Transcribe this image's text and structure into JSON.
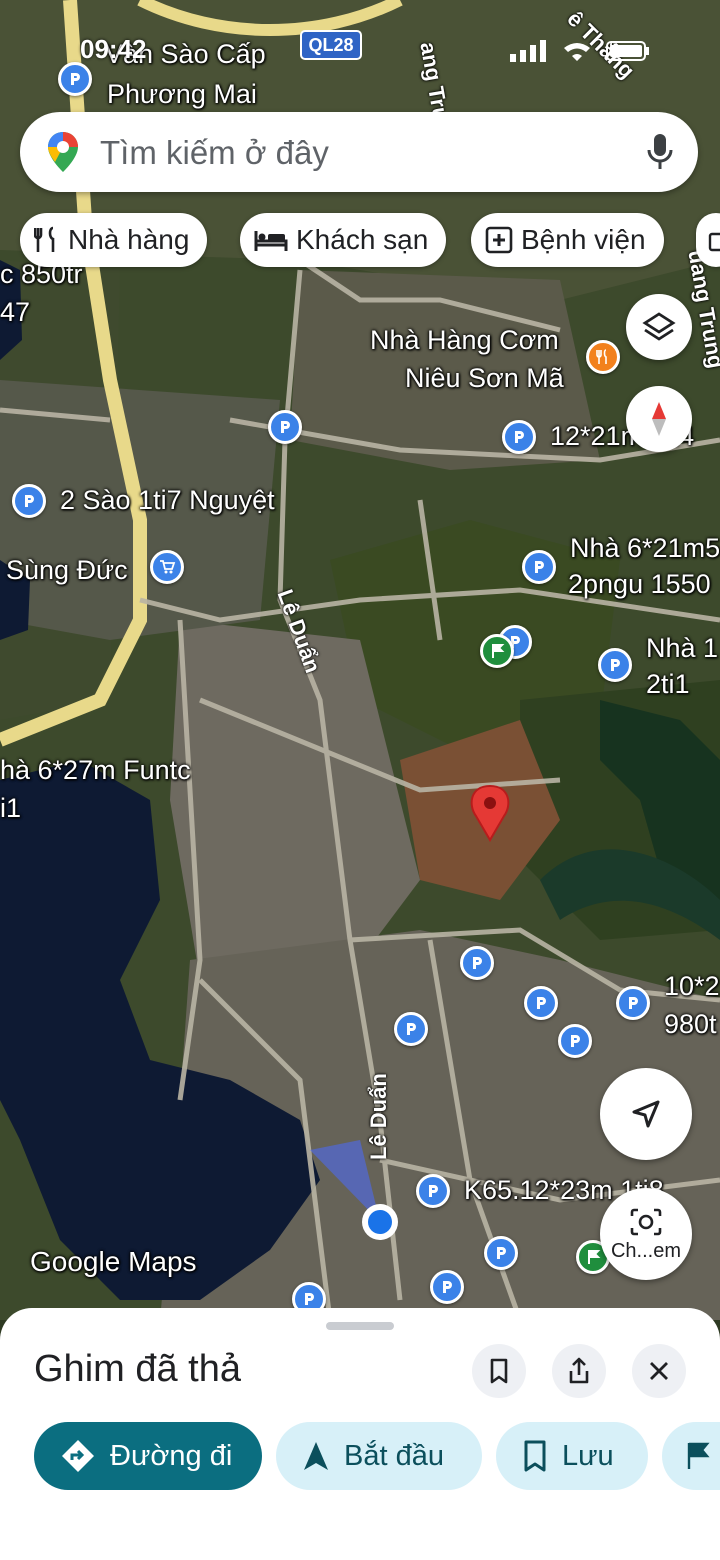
{
  "status_bar": {
    "time": "09:42"
  },
  "map": {
    "shields": [
      {
        "id": "QL28",
        "text": "QL28"
      }
    ],
    "labels": [
      {
        "id": "van-sao-1",
        "text": "Vàn Sào Cấp"
      },
      {
        "id": "van-sao-2",
        "text": "Phương Mai"
      },
      {
        "id": "quang-trung-top",
        "text": "ang Trung"
      },
      {
        "id": "le-thang",
        "text": "ê Thắng"
      },
      {
        "id": "c850",
        "text": "c 850tr"
      },
      {
        "id": "c47",
        "text": "47"
      },
      {
        "id": "nha-hang-1",
        "text": "Nhà Hàng Cơm"
      },
      {
        "id": "nha-hang-2",
        "text": "Niêu Sơn Mã"
      },
      {
        "id": "quang-trung-right",
        "text": "uang Trung"
      },
      {
        "id": "p12x21",
        "text": "12*21m 1ti4"
      },
      {
        "id": "hai-sao",
        "text": "2 Sào 1ti7 Nguyệt"
      },
      {
        "id": "sung-duc",
        "text": "Sùng Đức"
      },
      {
        "id": "nha6x21-1",
        "text": "Nhà 6*21m5"
      },
      {
        "id": "nha6x21-2",
        "text": "2pngu 1550"
      },
      {
        "id": "nha1-1",
        "text": "Nhà 1"
      },
      {
        "id": "nha1-2",
        "text": "2ti1"
      },
      {
        "id": "nha6x27-1",
        "text": "hà 6*27m Funtc"
      },
      {
        "id": "nha6x27-2",
        "text": "i1"
      },
      {
        "id": "p10x2-1",
        "text": "10*2"
      },
      {
        "id": "p10x2-2",
        "text": "980t"
      },
      {
        "id": "k65",
        "text": "K65.12*23m 1ti8"
      },
      {
        "id": "google-maps",
        "text": "Google Maps"
      }
    ],
    "road_labels": [
      {
        "id": "le-duan-1",
        "text": "Lê Duẩn"
      },
      {
        "id": "le-duan-2",
        "text": "Lê Duẩn"
      }
    ]
  },
  "search": {
    "placeholder": "Tìm kiếm ở đây"
  },
  "chips": [
    {
      "id": "restaurants",
      "label": "Nhà hàng",
      "icon": "fork-knife-icon"
    },
    {
      "id": "hotels",
      "label": "Khách sạn",
      "icon": "bed-icon"
    },
    {
      "id": "hospitals",
      "label": "Bệnh viện",
      "icon": "medical-cross-icon"
    }
  ],
  "fabs": {
    "layers_icon": "layers-icon",
    "compass_icon": "compass-icon",
    "location_icon": "navigation-arrow-icon",
    "lens_label": "Ch...em"
  },
  "sheet": {
    "title": "Ghim đã thả",
    "actions": [
      {
        "id": "directions",
        "label": "Đường đi",
        "icon": "directions-icon"
      },
      {
        "id": "start",
        "label": "Bắt đầu",
        "icon": "navigation-icon"
      },
      {
        "id": "save",
        "label": "Lưu",
        "icon": "bookmark-icon"
      }
    ]
  },
  "colors": {
    "accent": "#0b6e80",
    "secondary_bg": "#d7f0f8",
    "pin_blue": "#3b82e8",
    "drop_pin": "#e53935",
    "pin_green": "#1f8e3d"
  }
}
